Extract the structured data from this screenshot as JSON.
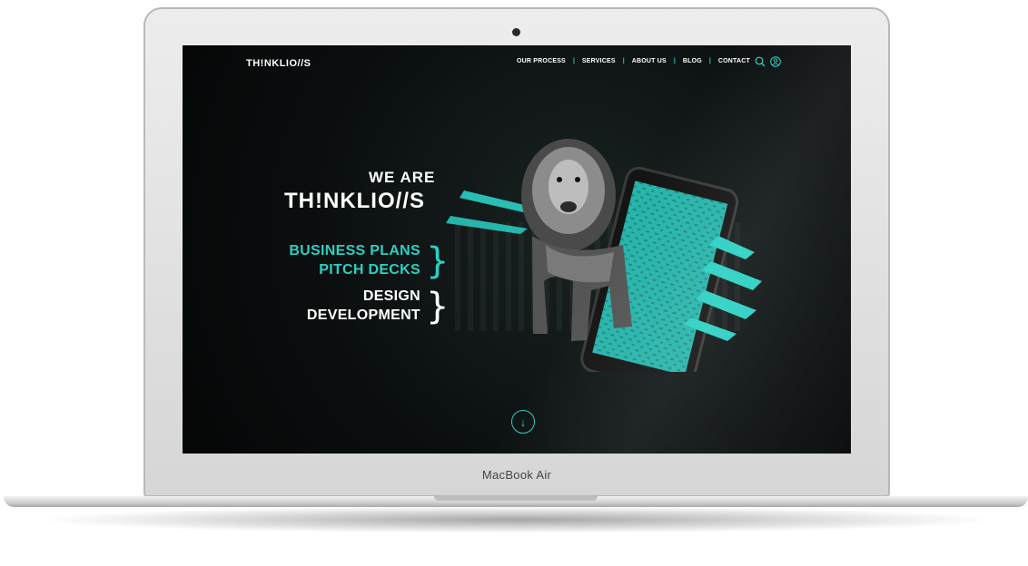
{
  "device": {
    "label": "MacBook Air"
  },
  "site": {
    "logo": "TH!NKLIO//S",
    "nav": [
      "OUR PROCESS",
      "SERVICES",
      "ABOUT US",
      "BLOG",
      "CONTACT"
    ],
    "nav_separator": "|",
    "icons": [
      "search-icon",
      "user-icon"
    ],
    "hero": {
      "line1": "WE ARE",
      "line2": "TH!NKLIO//S",
      "services_group1": [
        "BUSINESS PLANS",
        "PITCH DECKS"
      ],
      "services_group2": [
        "DESIGN",
        "DEVELOPMENT"
      ]
    },
    "scroll_icon": "arrow-down-icon",
    "scroll_glyph": "↓"
  },
  "colors": {
    "accent": "#2ad0c4",
    "background": "#0b0f0f",
    "text": "#ffffff"
  }
}
